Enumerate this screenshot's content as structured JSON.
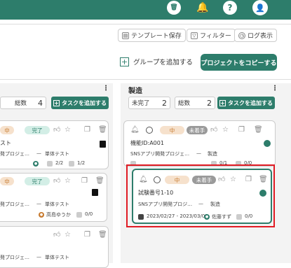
{
  "header": {
    "trash_icon": "🗑",
    "bell_icon": "🔔",
    "help_label": "?",
    "avatar_icon": "👤"
  },
  "toolbar": {
    "template_save": "テンプレート保存",
    "filter": "フィルター",
    "log_view": "ログ表示",
    "add_group": "グループを追加する",
    "copy_project": "プロジェクトをコピーする",
    "add_plus": "+"
  },
  "left_column": {
    "stat_label": "総数",
    "stat_value": "4",
    "add_task": "タスクを追加する",
    "card1": {
      "priority": "中",
      "status": "完了",
      "title": "スト",
      "project": "発プロジェ…",
      "phase": "単体テスト",
      "ratio_a": "2/2",
      "ratio_b": "1/2"
    },
    "card2": {
      "priority": "中",
      "status": "完了",
      "project": "発プロジェ…",
      "phase": "単体テスト",
      "assignee": "高島ゆうか",
      "ratio": "0/0"
    },
    "card3": {
      "project": "発プロジェ…",
      "phase": "単体テスト"
    }
  },
  "right_column": {
    "title": "製造",
    "stat1_label": "未完了",
    "stat1_value": "2",
    "stat2_label": "総数",
    "stat2_value": "2",
    "add_task": "タスクを追加する",
    "card1": {
      "priority": "中",
      "status": "未着手",
      "title": "機能ID:A001",
      "project": "SNSアプリ開発プロジェ…",
      "phase": "製造",
      "ratio_a": "0/1",
      "ratio_b": "0/0"
    },
    "card2": {
      "priority": "中",
      "status": "未着手",
      "title": "試験番号1-10",
      "project": "SNSアプリ開発プロジ…",
      "phase": "製造",
      "dates": "2023/02/27 - 2023/03/03",
      "assignee": "佐藤すず",
      "ratio": "0/0"
    }
  },
  "colors": {
    "accent": "#2d7d6b",
    "highlight": "#e01b24"
  }
}
